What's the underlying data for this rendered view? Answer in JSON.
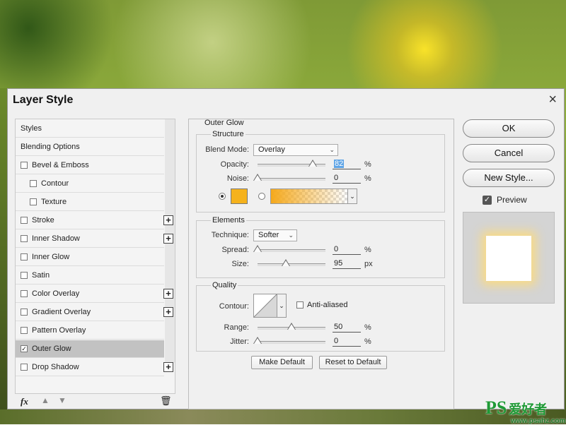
{
  "dialog": {
    "title": "Layer Style",
    "close_icon": "×"
  },
  "styles_list": {
    "items": [
      {
        "label": "Styles",
        "checkbox": false,
        "checked": false,
        "indent": 0,
        "plus": false,
        "selected": false
      },
      {
        "label": "Blending Options",
        "checkbox": false,
        "checked": false,
        "indent": 0,
        "plus": false,
        "selected": false
      },
      {
        "label": "Bevel & Emboss",
        "checkbox": true,
        "checked": false,
        "indent": 0,
        "plus": false,
        "selected": false
      },
      {
        "label": "Contour",
        "checkbox": true,
        "checked": false,
        "indent": 1,
        "plus": false,
        "selected": false
      },
      {
        "label": "Texture",
        "checkbox": true,
        "checked": false,
        "indent": 1,
        "plus": false,
        "selected": false
      },
      {
        "label": "Stroke",
        "checkbox": true,
        "checked": false,
        "indent": 0,
        "plus": true,
        "selected": false
      },
      {
        "label": "Inner Shadow",
        "checkbox": true,
        "checked": false,
        "indent": 0,
        "plus": true,
        "selected": false
      },
      {
        "label": "Inner Glow",
        "checkbox": true,
        "checked": false,
        "indent": 0,
        "plus": false,
        "selected": false
      },
      {
        "label": "Satin",
        "checkbox": true,
        "checked": false,
        "indent": 0,
        "plus": false,
        "selected": false
      },
      {
        "label": "Color Overlay",
        "checkbox": true,
        "checked": false,
        "indent": 0,
        "plus": true,
        "selected": false
      },
      {
        "label": "Gradient Overlay",
        "checkbox": true,
        "checked": false,
        "indent": 0,
        "plus": true,
        "selected": false
      },
      {
        "label": "Pattern Overlay",
        "checkbox": true,
        "checked": false,
        "indent": 0,
        "plus": false,
        "selected": false
      },
      {
        "label": "Outer Glow",
        "checkbox": true,
        "checked": true,
        "indent": 0,
        "plus": false,
        "selected": true
      },
      {
        "label": "Drop Shadow",
        "checkbox": true,
        "checked": false,
        "indent": 0,
        "plus": true,
        "selected": false
      }
    ],
    "fx_label": "fx",
    "move_up_icon": "arrow-up-icon",
    "move_down_icon": "arrow-down-icon",
    "delete_icon": "trash-icon"
  },
  "outer_glow": {
    "section_title": "Outer Glow",
    "structure": {
      "title": "Structure",
      "blend_mode_label": "Blend Mode:",
      "blend_mode_value": "Overlay",
      "opacity_label": "Opacity:",
      "opacity_value": "82",
      "opacity_unit": "%",
      "noise_label": "Noise:",
      "noise_value": "0",
      "noise_unit": "%",
      "color_swatch": "#f5b21c",
      "gradient_start": "#f5a91c"
    },
    "elements": {
      "title": "Elements",
      "technique_label": "Technique:",
      "technique_value": "Softer",
      "spread_label": "Spread:",
      "spread_value": "0",
      "spread_unit": "%",
      "size_label": "Size:",
      "size_value": "95",
      "size_unit": "px"
    },
    "quality": {
      "title": "Quality",
      "contour_label": "Contour:",
      "anti_aliased_label": "Anti-aliased",
      "range_label": "Range:",
      "range_value": "50",
      "range_unit": "%",
      "jitter_label": "Jitter:",
      "jitter_value": "0",
      "jitter_unit": "%"
    },
    "make_default_label": "Make Default",
    "reset_default_label": "Reset to Default"
  },
  "actions": {
    "ok_label": "OK",
    "cancel_label": "Cancel",
    "new_style_label": "New Style...",
    "preview_label": "Preview",
    "preview_checked": true
  },
  "watermark": {
    "ps": "PS",
    "cn": "爱好者",
    "url": "www.psahz.com"
  }
}
